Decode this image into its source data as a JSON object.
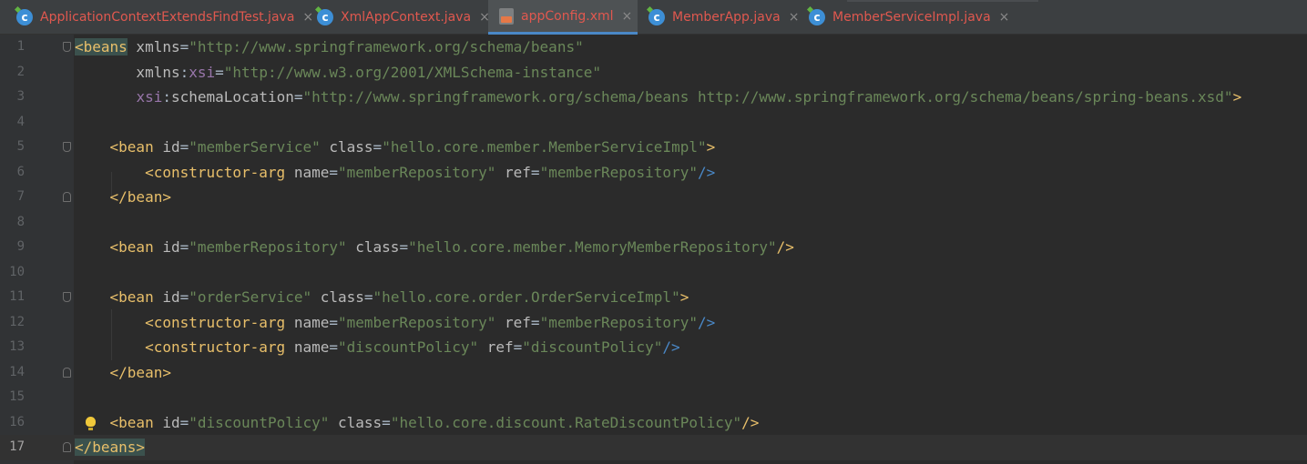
{
  "tabs": [
    {
      "label": "ApplicationContextExtendsFindTest.java",
      "icon": "java-class-icon",
      "active": false
    },
    {
      "label": "XmlAppContext.java",
      "icon": "java-class-icon",
      "active": false
    },
    {
      "label": "appConfig.xml",
      "icon": "xml-file-icon",
      "active": true
    },
    {
      "label": "MemberApp.java",
      "icon": "java-class-icon",
      "active": false
    },
    {
      "label": "MemberServiceImpl.java",
      "icon": "java-class-icon",
      "active": false
    }
  ],
  "close_glyph": "×",
  "colors": {
    "tag": "#e8bf6a",
    "attribute": "#bababa",
    "namespace": "#9876aa",
    "string_value": "#6a8759",
    "tab_label": "#e0584f",
    "background": "#2b2b2b"
  },
  "editor": {
    "current_line": 17,
    "lines": [
      {
        "n": "1",
        "tokens": [
          {
            "t": "<beans",
            "c": "tgh"
          },
          {
            "t": " xmlns",
            "c": "at"
          },
          {
            "t": "=",
            "c": "pn"
          },
          {
            "t": "\"http://www.springframework.org/schema/beans\"",
            "c": "vl"
          }
        ]
      },
      {
        "n": "2",
        "tokens": [
          {
            "t": "       xmlns",
            "c": "at"
          },
          {
            "t": ":",
            "c": "pn"
          },
          {
            "t": "xsi",
            "c": "ns"
          },
          {
            "t": "=",
            "c": "pn"
          },
          {
            "t": "\"http://www.w3.org/2001/XMLSchema-instance\"",
            "c": "vl"
          }
        ]
      },
      {
        "n": "3",
        "tokens": [
          {
            "t": "       ",
            "c": "pn"
          },
          {
            "t": "xsi",
            "c": "ns"
          },
          {
            "t": ":",
            "c": "pn"
          },
          {
            "t": "schemaLocation",
            "c": "at"
          },
          {
            "t": "=",
            "c": "pn"
          },
          {
            "t": "\"http://www.springframework.org/schema/beans http://www.springframework.org/schema/beans/spring-beans.xsd\"",
            "c": "vl"
          },
          {
            "t": ">",
            "c": "tg"
          }
        ]
      },
      {
        "n": "4",
        "tokens": []
      },
      {
        "n": "5",
        "tokens": [
          {
            "t": "    <bean",
            "c": "tg"
          },
          {
            "t": " id",
            "c": "at"
          },
          {
            "t": "=",
            "c": "pn"
          },
          {
            "t": "\"memberService\"",
            "c": "vl"
          },
          {
            "t": " class",
            "c": "at"
          },
          {
            "t": "=",
            "c": "pn"
          },
          {
            "t": "\"hello.core.member.MemberServiceImpl\"",
            "c": "vl"
          },
          {
            "t": ">",
            "c": "tg"
          }
        ]
      },
      {
        "n": "6",
        "tokens": [
          {
            "t": "        <constructor-arg",
            "c": "tg"
          },
          {
            "t": " name",
            "c": "at"
          },
          {
            "t": "=",
            "c": "pn"
          },
          {
            "t": "\"memberRepository\"",
            "c": "vl"
          },
          {
            "t": " ref",
            "c": "at"
          },
          {
            "t": "=",
            "c": "pn"
          },
          {
            "t": "\"memberRepository\"",
            "c": "vl"
          },
          {
            "t": "/>",
            "c": "sl"
          }
        ]
      },
      {
        "n": "7",
        "tokens": [
          {
            "t": "    </bean>",
            "c": "tg"
          }
        ]
      },
      {
        "n": "8",
        "tokens": []
      },
      {
        "n": "9",
        "tokens": [
          {
            "t": "    <bean",
            "c": "tg"
          },
          {
            "t": " id",
            "c": "at"
          },
          {
            "t": "=",
            "c": "pn"
          },
          {
            "t": "\"memberRepository\"",
            "c": "vl"
          },
          {
            "t": " class",
            "c": "at"
          },
          {
            "t": "=",
            "c": "pn"
          },
          {
            "t": "\"hello.core.member.MemoryMemberRepository\"",
            "c": "vl"
          },
          {
            "t": "/>",
            "c": "tg"
          }
        ]
      },
      {
        "n": "10",
        "tokens": []
      },
      {
        "n": "11",
        "tokens": [
          {
            "t": "    <bean",
            "c": "tg"
          },
          {
            "t": " id",
            "c": "at"
          },
          {
            "t": "=",
            "c": "pn"
          },
          {
            "t": "\"orderService\"",
            "c": "vl"
          },
          {
            "t": " class",
            "c": "at"
          },
          {
            "t": "=",
            "c": "pn"
          },
          {
            "t": "\"hello.core.order.OrderServiceImpl\"",
            "c": "vl"
          },
          {
            "t": ">",
            "c": "tg"
          }
        ]
      },
      {
        "n": "12",
        "tokens": [
          {
            "t": "        <constructor-arg",
            "c": "tg"
          },
          {
            "t": " name",
            "c": "at"
          },
          {
            "t": "=",
            "c": "pn"
          },
          {
            "t": "\"memberRepository\"",
            "c": "vl"
          },
          {
            "t": " ref",
            "c": "at"
          },
          {
            "t": "=",
            "c": "pn"
          },
          {
            "t": "\"memberRepository\"",
            "c": "vl"
          },
          {
            "t": "/>",
            "c": "sl"
          }
        ]
      },
      {
        "n": "13",
        "tokens": [
          {
            "t": "        <constructor-arg",
            "c": "tg"
          },
          {
            "t": " name",
            "c": "at"
          },
          {
            "t": "=",
            "c": "pn"
          },
          {
            "t": "\"discountPolicy\"",
            "c": "vl"
          },
          {
            "t": " ref",
            "c": "at"
          },
          {
            "t": "=",
            "c": "pn"
          },
          {
            "t": "\"discountPolicy\"",
            "c": "vl"
          },
          {
            "t": "/>",
            "c": "sl"
          }
        ]
      },
      {
        "n": "14",
        "tokens": [
          {
            "t": "    </bean>",
            "c": "tg"
          }
        ]
      },
      {
        "n": "15",
        "tokens": []
      },
      {
        "n": "16",
        "tokens": [
          {
            "t": "    <bean",
            "c": "tg"
          },
          {
            "t": " id",
            "c": "at"
          },
          {
            "t": "=",
            "c": "pn"
          },
          {
            "t": "\"discountPolicy\"",
            "c": "vl"
          },
          {
            "t": " class",
            "c": "at"
          },
          {
            "t": "=",
            "c": "pn"
          },
          {
            "t": "\"hello.core.discount.RateDiscountPolicy\"",
            "c": "vl"
          },
          {
            "t": "/>",
            "c": "tg"
          }
        ]
      },
      {
        "n": "17",
        "tokens": [
          {
            "t": "</beans>",
            "c": "tgh"
          }
        ]
      }
    ]
  }
}
